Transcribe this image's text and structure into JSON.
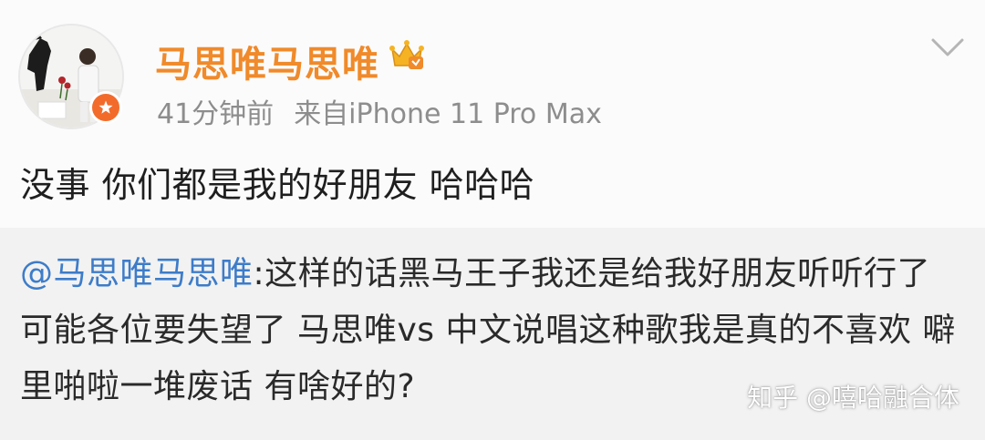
{
  "header": {
    "username": "马思唯马思唯",
    "time": "41分钟前",
    "source": "来自iPhone 11 Pro Max",
    "vip_icon": "vip-crown-icon",
    "menu_icon": "chevron-down-icon"
  },
  "post": {
    "content": "没事 你们都是我的好朋友 哈哈哈"
  },
  "quote": {
    "mention": "@马思唯马思唯",
    "text": ":这样的话黑马王子我还是给我好朋友听听行了 可能各位要失望了 马思唯vs 中文说唱这种歌我是真的不喜欢 噼里啪啦一堆废话 有啥好的?"
  },
  "watermark": "知乎 @嘻哈融合体",
  "colors": {
    "username": "#f08a2a",
    "mention": "#3d7cc9",
    "meta": "#8d8d8d",
    "quote_bg": "#f2f2f2",
    "badge": "#f36b2a"
  }
}
